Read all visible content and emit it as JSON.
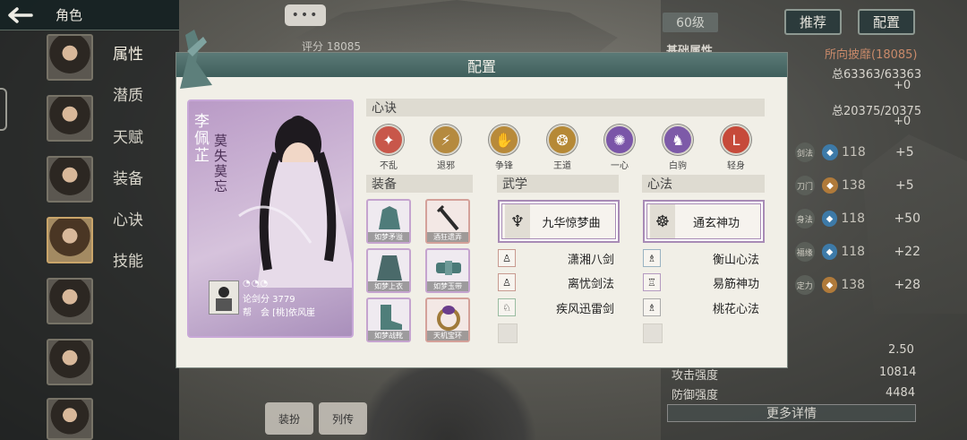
{
  "topbar": {
    "title": "角色",
    "back_icon": "back-arrow-icon"
  },
  "sidebar": {
    "tabs": [
      "属性",
      "潜质",
      "天赋",
      "装备",
      "心诀",
      "技能"
    ]
  },
  "background": {
    "chat_dots": "•••",
    "score_label": "评分 18085",
    "level": "60级",
    "recommend_button": "推荐",
    "config_button": "配置",
    "basic_attributes": "基础属性",
    "invincible_label": "所向披靡(18085)",
    "hp_total": "总63363/63363",
    "hp_plus": "+0",
    "mp_total": "总20375/20375",
    "mp_plus": "+0",
    "stat_rows": [
      {
        "label": "剑法",
        "value": "118",
        "delta": "+5",
        "color": "#3d7aa8"
      },
      {
        "label": "刀门",
        "value": "138",
        "delta": "+5",
        "color": "#b07a3a"
      },
      {
        "label": "身法",
        "value": "118",
        "delta": "+50",
        "color": "#3d7aa8"
      },
      {
        "label": "福缘",
        "value": "118",
        "delta": "+22",
        "color": "#3d7aa8"
      },
      {
        "label": "定力",
        "value": "138",
        "delta": "+28",
        "color": "#b07a3a"
      }
    ],
    "value_250": "2.50",
    "attack_label": "攻击强度",
    "attack_value": "10814",
    "defense_label": "防御强度",
    "defense_value": "4484",
    "more_details": "更多详情",
    "bottom_btn_1": "装扮",
    "bottom_btn_2": "列传"
  },
  "modal": {
    "title": "配置",
    "character": {
      "name": "李佩芷",
      "title": "莫失莫忘",
      "moons": "◔◔◔",
      "score": "论剑分 3779",
      "guild": "帮　会 [桃]依风崖"
    },
    "sections": {
      "xinjue": "心诀",
      "equipment": "装备",
      "wuxue": "武学",
      "xinfa": "心法"
    },
    "xinjue_items": [
      {
        "label": "不乱",
        "glyph": "✦",
        "color": "#c8574a"
      },
      {
        "label": "退邪",
        "glyph": "⚡",
        "color": "#b58a3f"
      },
      {
        "label": "争锋",
        "glyph": "✋",
        "color": "#b88a3a"
      },
      {
        "label": "王道",
        "glyph": "❂",
        "color": "#b68936"
      },
      {
        "label": "一心",
        "glyph": "✺",
        "color": "#7a55a8"
      },
      {
        "label": "白驹",
        "glyph": "♞",
        "color": "#7d5aa8"
      },
      {
        "label": "轻身",
        "glyph": "L",
        "color": "#c64a3a"
      }
    ],
    "equipment_items": [
      {
        "name": "如梦矛溢",
        "color": "#4f7c7a"
      },
      {
        "name": "酒狂遗弄",
        "color": "#2b2b2b"
      },
      {
        "name": "如梦上衣",
        "color": "#4a6a6a"
      },
      {
        "name": "如梦玉带",
        "color": "#4a7a78"
      },
      {
        "name": "如梦战靴",
        "color": "#4f7e7a"
      },
      {
        "name": "天机宝环",
        "color": "#6a3d8c"
      }
    ],
    "wuxue_main": "九华惊梦曲",
    "wuxue_list": [
      "潇湘八剑",
      "离忧剑法",
      "疾风迅雷剑"
    ],
    "xinfa_main": "通玄神功",
    "xinfa_list": [
      "衡山心法",
      "易筋神功",
      "桃花心法"
    ]
  }
}
